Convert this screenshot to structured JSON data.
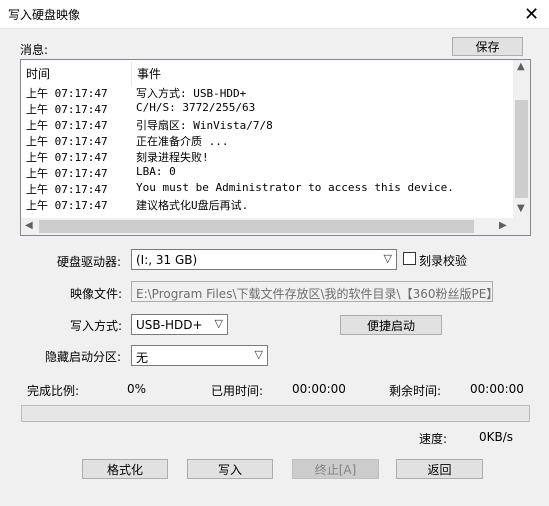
{
  "window": {
    "title": "写入硬盘映像",
    "close_glyph": "✕"
  },
  "messages": {
    "label": "消息:",
    "save_label": "保存",
    "columns": {
      "time": "时间",
      "event": "事件"
    },
    "rows": [
      {
        "time": "上午 07:17:47",
        "event": "写入方式: USB-HDD+"
      },
      {
        "time": "上午 07:17:47",
        "event": "C/H/S: 3772/255/63"
      },
      {
        "time": "上午 07:17:47",
        "event": "引导扇区: WinVista/7/8"
      },
      {
        "time": "上午 07:17:47",
        "event": "正在准备介质 ..."
      },
      {
        "time": "上午 07:17:47",
        "event": "刻录进程失败!"
      },
      {
        "time": "上午 07:17:47",
        "event": "LBA: 0"
      },
      {
        "time": "上午 07:17:47",
        "event": "You must be Administrator to access this device."
      },
      {
        "time": "上午 07:17:47",
        "event": "建议格式化U盘后再试."
      }
    ]
  },
  "form": {
    "drive_label": "硬盘驱动器:",
    "drive_value": "(I:, 31 GB)",
    "verify_label": "刻录校验",
    "verify_checked": false,
    "image_label": "映像文件:",
    "image_value": "E:\\Program Files\\下载文件存放区\\我的软件目录\\【360粉丝版PE】",
    "write_mode_label": "写入方式:",
    "write_mode_value": "USB-HDD+",
    "quick_boot_label": "便捷启动",
    "hidden_partition_label": "隐藏启动分区:",
    "hidden_partition_value": "无"
  },
  "status": {
    "complete_label": "完成比例:",
    "complete_value": "0%",
    "complete_fraction": 0,
    "elapsed_label": "已用时间:",
    "elapsed_value": "00:00:00",
    "remaining_label": "剩余时间:",
    "remaining_value": "00:00:00",
    "speed_label": "速度:",
    "speed_value": "0KB/s"
  },
  "buttons": {
    "format": "格式化",
    "write": "写入",
    "abort": "终止[A]",
    "back": "返回"
  }
}
